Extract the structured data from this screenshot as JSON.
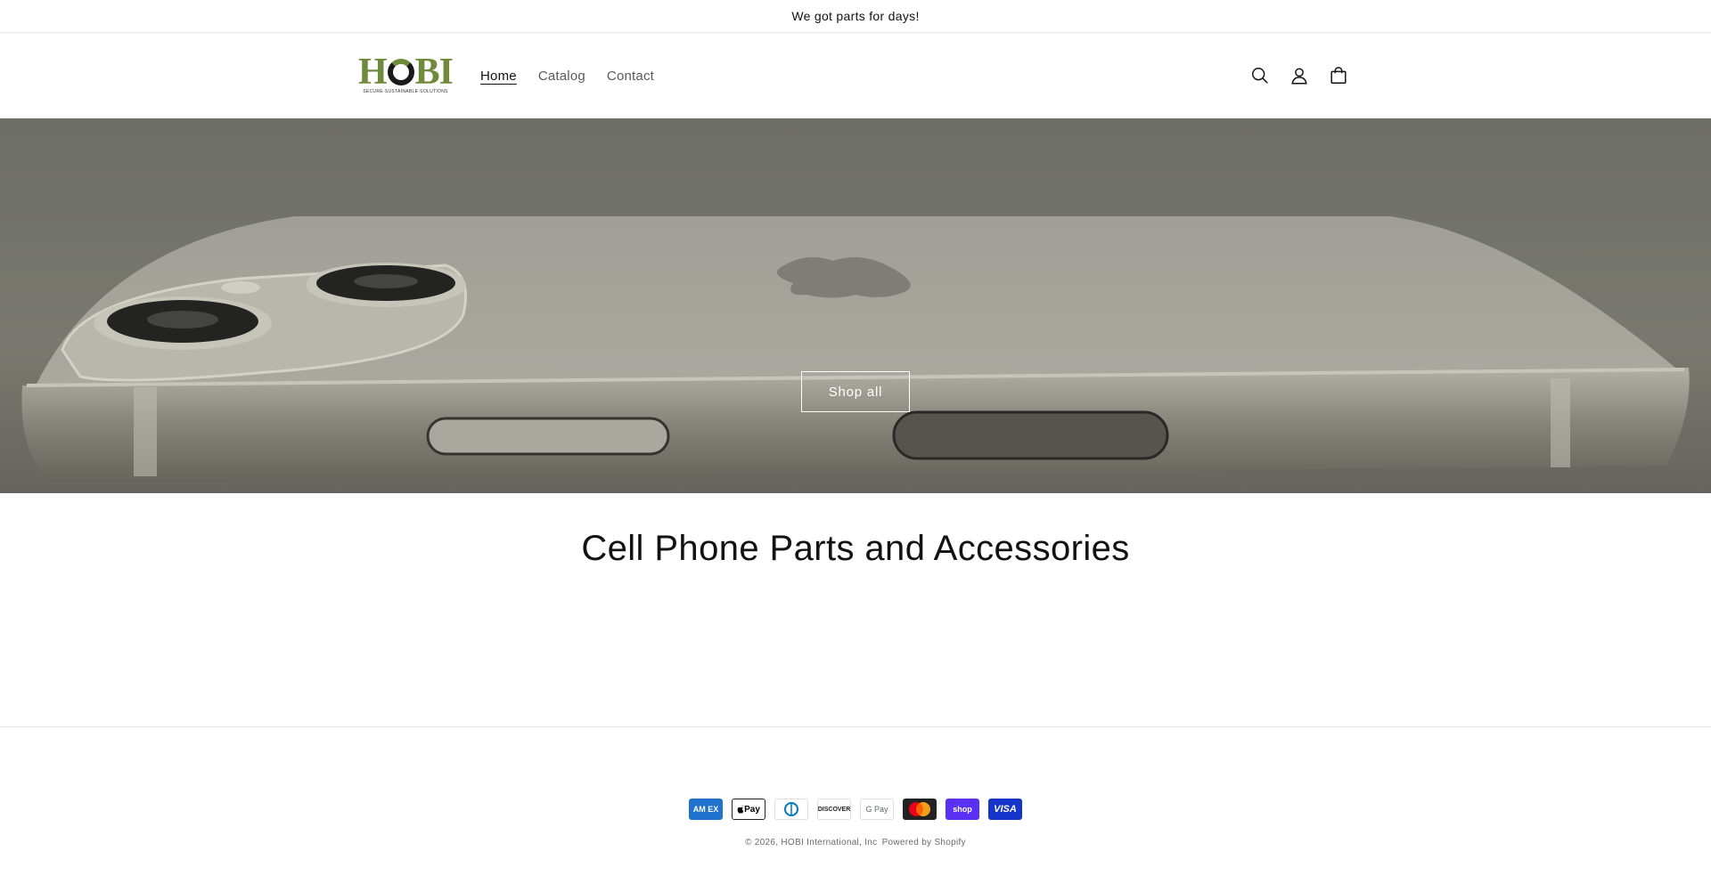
{
  "announcement": {
    "text": "We got parts for days!"
  },
  "header": {
    "logo": {
      "word_left": "H",
      "word_right": "BI",
      "tagline": "SECURE·SUSTAINABLE·SOLUTIONS"
    },
    "nav": [
      {
        "label": "Home",
        "active": true
      },
      {
        "label": "Catalog",
        "active": false
      },
      {
        "label": "Contact",
        "active": false
      }
    ],
    "icons": [
      "search-icon",
      "account-icon",
      "cart-icon"
    ]
  },
  "hero": {
    "button_label": "Shop all"
  },
  "collection": {
    "title": "Cell Phone Parts and Accessories"
  },
  "footer": {
    "payments": [
      {
        "name": "amex",
        "label": "AM EX"
      },
      {
        "name": "apple-pay",
        "label": "Pay"
      },
      {
        "name": "diners",
        "label": ""
      },
      {
        "name": "discover",
        "label": "DISCOVER"
      },
      {
        "name": "google-pay",
        "label": "G Pay"
      },
      {
        "name": "mastercard",
        "label": ""
      },
      {
        "name": "shop-pay",
        "label": "shop"
      },
      {
        "name": "visa",
        "label": "VISA"
      }
    ],
    "copyright": "© 2026, HOBI International, Inc",
    "powered_by": "Powered by Shopify"
  },
  "colors": {
    "brand_green": "#6e8a3c",
    "text": "#121212",
    "muted": "#5a5a5a"
  }
}
